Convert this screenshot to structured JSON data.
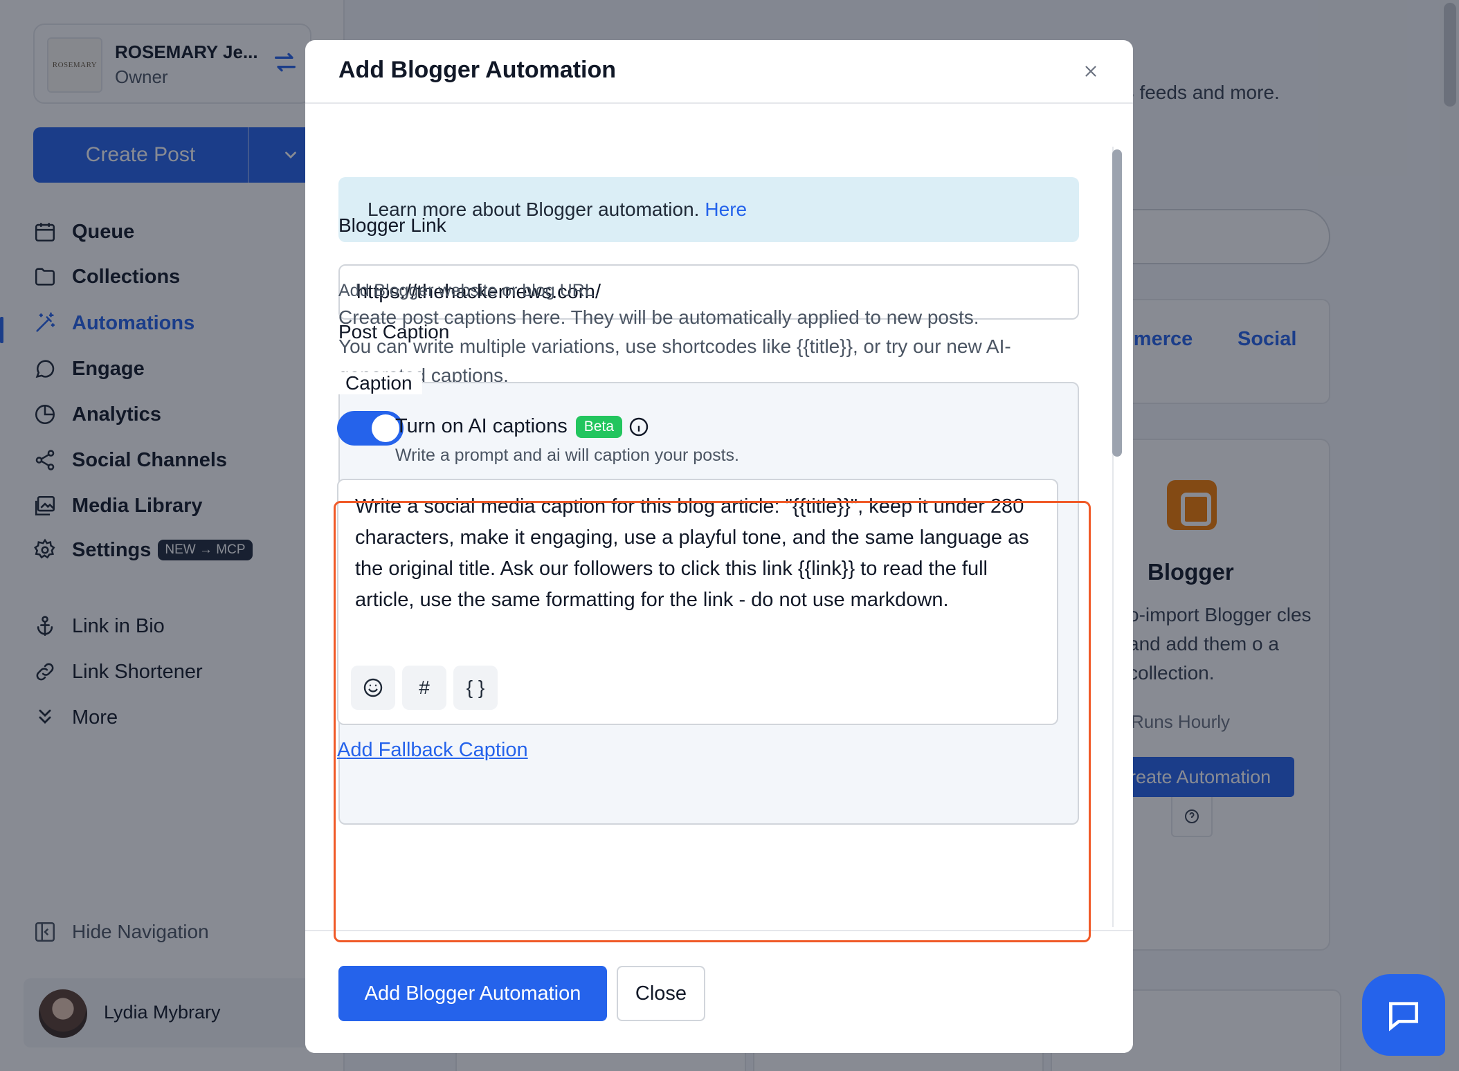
{
  "account": {
    "name": "ROSEMARY Je...",
    "role": "Owner",
    "logo_text": "ROSEMARY"
  },
  "create_post": {
    "label": "Create Post"
  },
  "nav": [
    {
      "label": "Queue",
      "icon": "calendar-icon"
    },
    {
      "label": "Collections",
      "icon": "folder-icon"
    },
    {
      "label": "Automations",
      "icon": "magic-wand-icon",
      "active": true
    },
    {
      "label": "Engage",
      "icon": "chat-bubble-icon"
    },
    {
      "label": "Analytics",
      "icon": "pie-chart-icon"
    },
    {
      "label": "Social Channels",
      "icon": "share-icon"
    },
    {
      "label": "Media Library",
      "icon": "image-stack-icon"
    },
    {
      "label": "Settings",
      "icon": "gear-icon",
      "badge": "NEW → MCP"
    }
  ],
  "nav_secondary": [
    {
      "label": "Link in Bio",
      "icon": "anchor-icon"
    },
    {
      "label": "Link Shortener",
      "icon": "link-icon"
    },
    {
      "label": "More",
      "icon": "chevrons-down-icon"
    }
  ],
  "hide_nav": {
    "label": "Hide Navigation"
  },
  "user": {
    "name": "Lydia Mybrary"
  },
  "background": {
    "subtitle_fragment": "S feeds and more.",
    "tabs": [
      "mmerce",
      "Social"
    ],
    "card": {
      "title": "Blogger",
      "description": "o-import Blogger cles and add them o a collection.",
      "runs": "Runs Hourly",
      "create_label": "reate Automation"
    }
  },
  "modal": {
    "title": "Add Blogger Automation",
    "info_text": "Learn more about Blogger automation.",
    "info_link": "Here",
    "blogger_link": {
      "label": "Blogger Link",
      "value": "https://thehackernews.com/",
      "help": "Add Blogger website or blog URL."
    },
    "post_caption": {
      "label": "Post Caption",
      "desc1": "Create post captions here. They will be automatically applied to new posts.",
      "desc2": "You can write multiple variations, use shortcodes like {{title}}, or try our new AI-generated captions."
    },
    "caption": {
      "legend": "Caption",
      "ai_toggle_label": "Turn on AI captions",
      "ai_toggle_on": true,
      "beta_badge": "Beta",
      "ai_help": "Write a prompt and ai will caption your posts.",
      "prompt": "Write a social media caption for this blog article: \"{{title}}\", keep it under 280 characters, make it engaging, use a playful tone, and the same language as the original title. Ask our followers to click this link {{link}} to read the full article, use the same formatting for the link - do not use markdown.",
      "tools": [
        "emoji-icon",
        "hashtag-icon",
        "braces-icon"
      ],
      "hashtag_glyph": "#",
      "braces_glyph": "{ }",
      "fallback_link": "Add Fallback Caption"
    },
    "footer": {
      "primary": "Add Blogger Automation",
      "secondary": "Close"
    }
  },
  "colors": {
    "accent": "#2563eb",
    "highlight": "#f05a28",
    "beta": "#22c55e",
    "info_bg": "#dbeef6"
  }
}
